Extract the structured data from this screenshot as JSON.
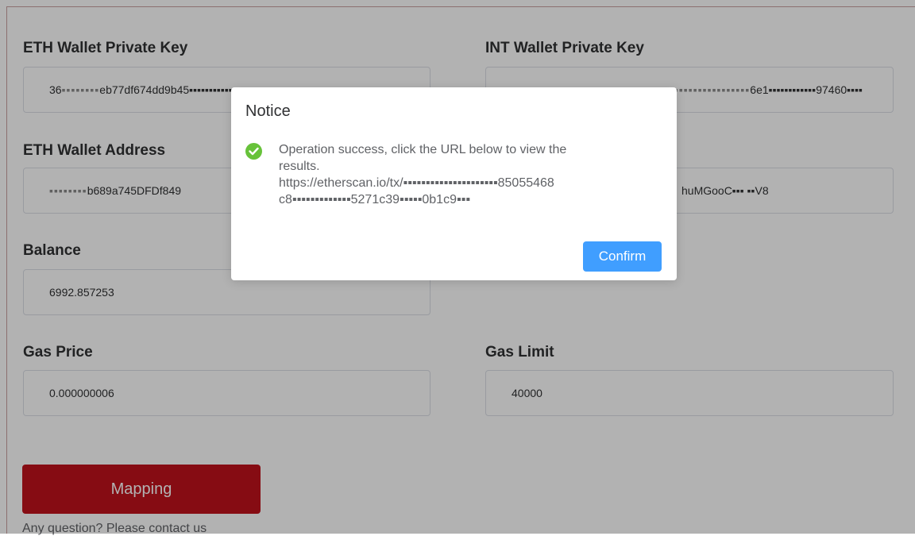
{
  "form": {
    "eth_private_key": {
      "label": "ETH Wallet Private Key",
      "value": "36",
      "value_masked": "▪▪▪▪▪▪▪▪",
      "value_tail": "eb77df674dd9b45▪▪▪▪▪▪▪▪▪▪▪▪▪▪▪▪▪▪▪"
    },
    "int_private_key": {
      "label": "INT Wallet Private Key",
      "value_masked": "▪▪▪▪▪▪▪▪▪▪▪▪▪▪▪▪▪▪▪▪▪▪▪▪▪▪",
      "value_tail": "6e1▪▪▪▪▪▪▪▪▪▪▪▪97460▪▪▪▪"
    },
    "eth_address": {
      "label": "ETH Wallet Address",
      "value_masked": "▪▪▪▪▪▪▪▪",
      "value_tail": "b689a745DFDf849"
    },
    "int_address": {
      "value_tail": "huMGooC▪▪▪ ▪▪V8"
    },
    "balance": {
      "label": "Balance",
      "value": "6992.857253"
    },
    "gas_price": {
      "label": "Gas Price",
      "value": "0.000000006"
    },
    "gas_limit": {
      "label": "Gas Limit",
      "value": "40000"
    },
    "mapping_button": "Mapping",
    "contact": "Any question? Please contact us"
  },
  "dialog": {
    "title": "Notice",
    "message_line1": "Operation success, click the URL below to view the",
    "message_line2": "results.",
    "url_line1": "https://etherscan.io/tx/▪▪▪▪▪▪▪▪▪▪▪▪▪▪▪▪▪▪▪▪▪85055468",
    "url_line2": "c8▪▪▪▪▪▪▪▪▪▪▪▪▪5271c39▪▪▪▪▪0b1c9▪▪▪",
    "confirm_button": "Confirm",
    "icon": "check-circle-icon",
    "icon_color": "#67c23a",
    "confirm_color": "#409eff"
  },
  "colors": {
    "mapping_button": "#c0121c"
  }
}
